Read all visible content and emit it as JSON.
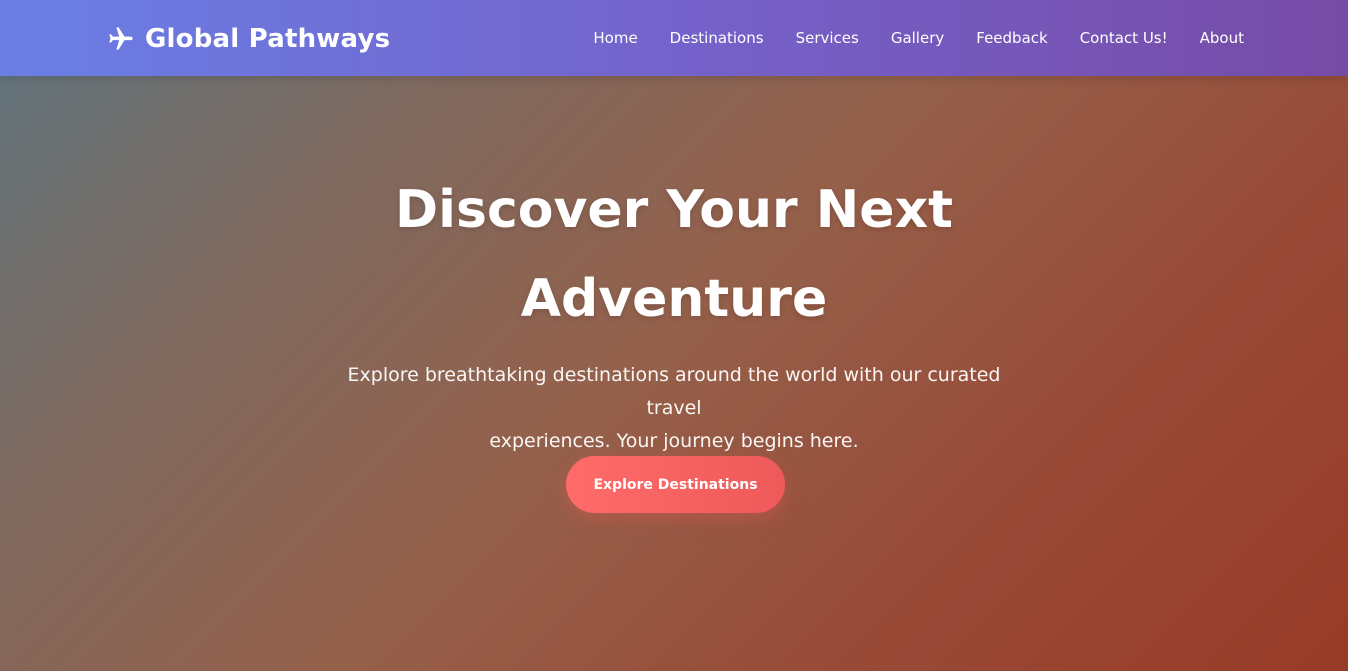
{
  "brand": {
    "icon": "airplane-icon",
    "name": "Global Pathways"
  },
  "nav": {
    "items": [
      {
        "label": "Home"
      },
      {
        "label": "Destinations"
      },
      {
        "label": "Services"
      },
      {
        "label": "Gallery"
      },
      {
        "label": "Feedback"
      },
      {
        "label": "Contact Us!"
      },
      {
        "label": "About"
      }
    ]
  },
  "hero": {
    "title_line1": "Discover Your Next",
    "title_line2": "Adventure",
    "subtitle_line1": "Explore breathtaking destinations around the world with our curated travel",
    "subtitle_line2": "experiences. Your journey begins here.",
    "cta_label": "Explore Destinations"
  },
  "colors": {
    "navbar_start": "#6a7fe5",
    "navbar_end": "#764ba6",
    "cta": "#ff6a6a",
    "hero_overlay_start": "#5f7680",
    "hero_overlay_end": "#983b28"
  }
}
